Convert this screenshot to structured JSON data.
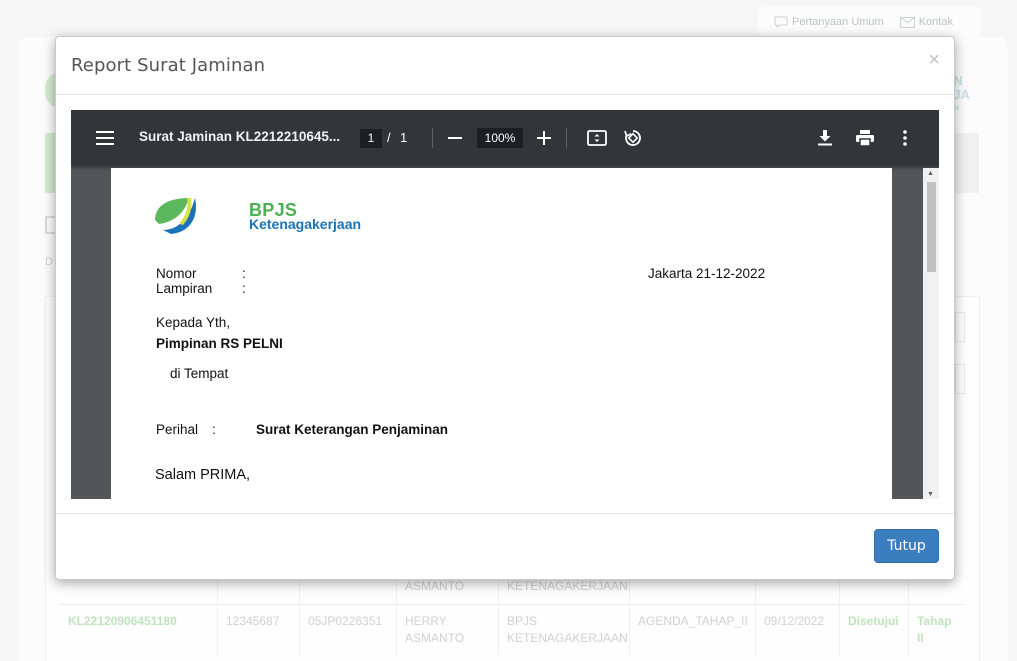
{
  "background": {
    "topbar": {
      "faq_label": "Pertanyaan Umum",
      "contact_label": "Kontak"
    },
    "logo_text": [
      "AN",
      "RJA",
      "AAN"
    ],
    "side_letter": "D",
    "rows": [
      {
        "cells": [
          "",
          "",
          "",
          "ASMANTO",
          "KETENAGAKERJAAN",
          "",
          "",
          "",
          ""
        ]
      },
      {
        "cells": [
          "KL22120906451180",
          "12345687",
          "05JP0226351",
          "HERRY ASMANTO",
          "BPJS KETENAGAKERJAAN",
          "AGENDA_TAHAP_II",
          "09/12/2022",
          "Disetujui",
          "Tahap II"
        ]
      }
    ]
  },
  "modal": {
    "title": "Report Surat Jaminan",
    "close_symbol": "×",
    "close_button_label": "Tutup"
  },
  "viewer": {
    "doc_title": "Surat Jaminan KL2212210645...",
    "current_page": "1",
    "page_separator": "/",
    "total_pages": "1",
    "zoom": "100%",
    "icons": [
      "menu-icon",
      "zoom-out-icon",
      "zoom-in-icon",
      "fit-page-icon",
      "rotate-icon",
      "download-icon",
      "print-icon",
      "more-icon"
    ]
  },
  "document": {
    "brand_name": "BPJS",
    "brand_sub": "Ketenagakerjaan",
    "nomor_label": "Nomor",
    "lampiran_label": "Lampiran",
    "colon": ":",
    "date_text": "Jakarta 21-12-2022",
    "kepada": "Kepada Yth,",
    "recipient": "Pimpinan RS PELNI",
    "place": "di Tempat",
    "perihal_label": "Perihal",
    "perihal_value": "Surat Keterangan Penjaminan",
    "greeting": "Salam PRIMA,"
  },
  "colors": {
    "brand_green": "#4caf50",
    "brand_blue": "#1a73b8",
    "primary_button": "#3a7ebf",
    "toolbar": "#323639"
  }
}
